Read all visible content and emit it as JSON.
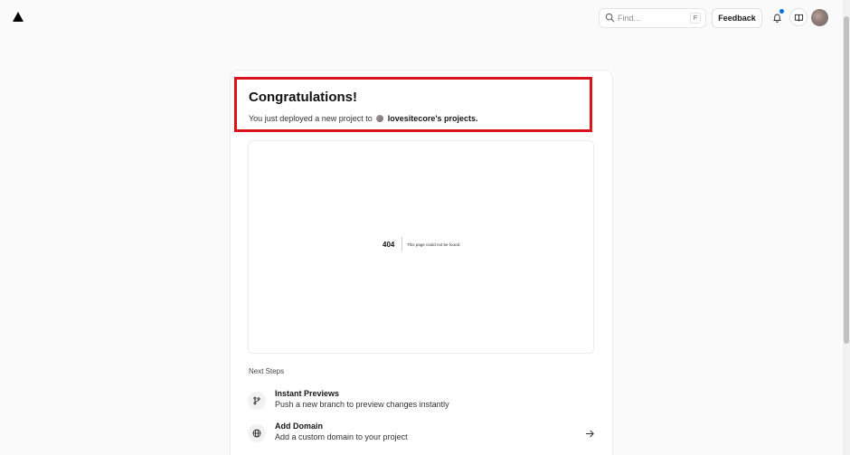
{
  "topbar": {
    "search_placeholder": "Find...",
    "search_shortcut": "F",
    "feedback_label": "Feedback",
    "notification_dot_color": "#0070f3"
  },
  "deploy": {
    "title": "Congratulations!",
    "subtitle_prefix": "You just deployed a new project to",
    "project_owner": "lovesitecore's projects."
  },
  "preview": {
    "status_code": "404",
    "message": "This page could not be found."
  },
  "next_steps": {
    "heading": "Next Steps",
    "items": [
      {
        "title": "Instant Previews",
        "description": "Push a new branch to preview changes instantly",
        "icon": "git-branch-icon"
      },
      {
        "title": "Add Domain",
        "description": "Add a custom domain to your project",
        "icon": "globe-icon"
      }
    ]
  },
  "colors": {
    "highlight_border": "#d9141b",
    "accent": "#0070f3"
  }
}
